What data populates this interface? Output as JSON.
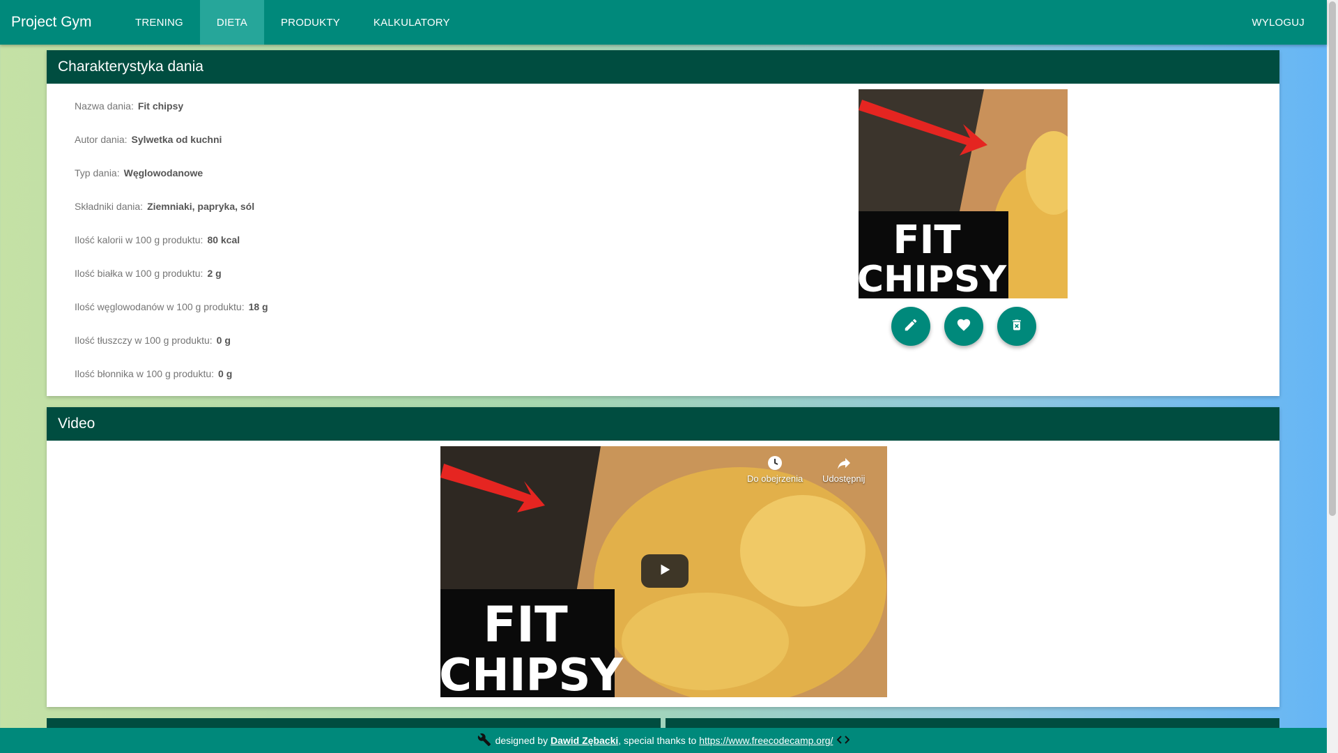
{
  "navbar": {
    "brand": "Project Gym",
    "items": [
      {
        "label": "TRENING"
      },
      {
        "label": "DIETA"
      },
      {
        "label": "PRODUKTY"
      },
      {
        "label": "KALKULATORY"
      }
    ],
    "logout": "WYLOGUJ"
  },
  "dish_card": {
    "title": "Charakterystyka dania",
    "details": [
      {
        "label": "Nazwa dania:",
        "value": "Fit chipsy"
      },
      {
        "label": "Autor dania:",
        "value": "Sylwetka od kuchni"
      },
      {
        "label": "Typ dania:",
        "value": "Węglowodanowe"
      },
      {
        "label": "Składniki dania:",
        "value": "Ziemniaki, papryka, sól"
      },
      {
        "label": "Ilość kalorii w 100 g produktu:",
        "value": "80 kcal"
      },
      {
        "label": "Ilość białka w 100 g produktu:",
        "value": "2 g"
      },
      {
        "label": "Ilość węglowodanów w 100 g produktu:",
        "value": "18 g"
      },
      {
        "label": "Ilość tłuszczy w 100 g produktu:",
        "value": "0 g"
      },
      {
        "label": "Ilość błonnika w 100 g produktu:",
        "value": "0 g"
      }
    ],
    "image_text": [
      "FIT",
      "CHIPSY"
    ],
    "buttons": [
      "edit-icon",
      "heart-icon",
      "delete-icon"
    ]
  },
  "video_card": {
    "title": "Video",
    "watch_later": "Do obejrzenia",
    "share": "Udostępnij",
    "thumbnail_text": [
      "FIT",
      "CHIPSY"
    ]
  },
  "footer": {
    "prefix": "designed by",
    "author": "Dawid Zębacki",
    "middle": ", special thanks to",
    "link": "https://www.freecodecamp.org/",
    "icons": [
      "wrench-icon",
      "code-icon"
    ]
  },
  "colors": {
    "primary": "#00897b",
    "header_dark": "#004d40",
    "active_tab": "#26a69a"
  }
}
